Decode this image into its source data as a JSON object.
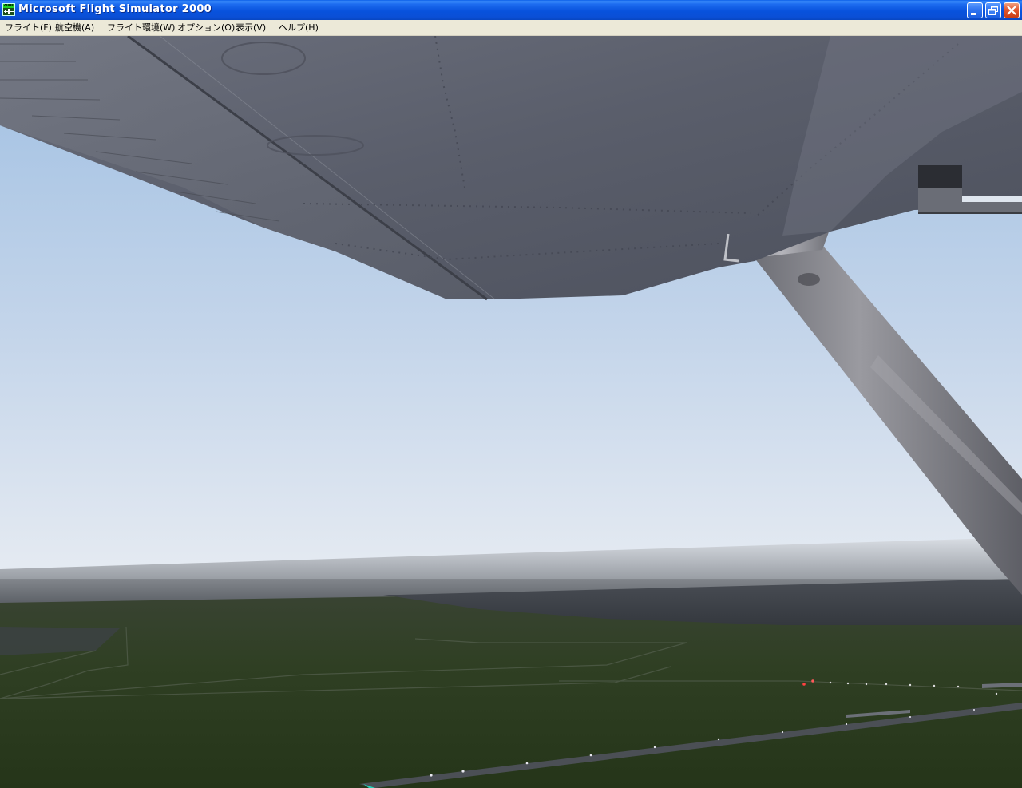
{
  "window": {
    "title": "Microsoft Flight Simulator 2000",
    "icon": "fs2000-app-icon",
    "icon_badge": "2000",
    "controls": [
      "minimize-icon",
      "restore-icon",
      "close-icon"
    ]
  },
  "menu": {
    "items": [
      {
        "label": "フライト(F)"
      },
      {
        "label": "航空機(A)"
      },
      {
        "label": "フライト環境(W)"
      },
      {
        "label": "オプション(O)"
      },
      {
        "label": "表示(V)"
      },
      {
        "label": "ヘルプ(H)"
      }
    ]
  },
  "scene": {
    "view": "exterior view under high wing",
    "colors": {
      "sky_top": "#a9c6e4",
      "sky_horizon": "#e3e9f1",
      "wing": "#5f6370",
      "strut": "#7c7d84",
      "ground": "#2c3a1f",
      "water": "#3a3d44"
    }
  }
}
